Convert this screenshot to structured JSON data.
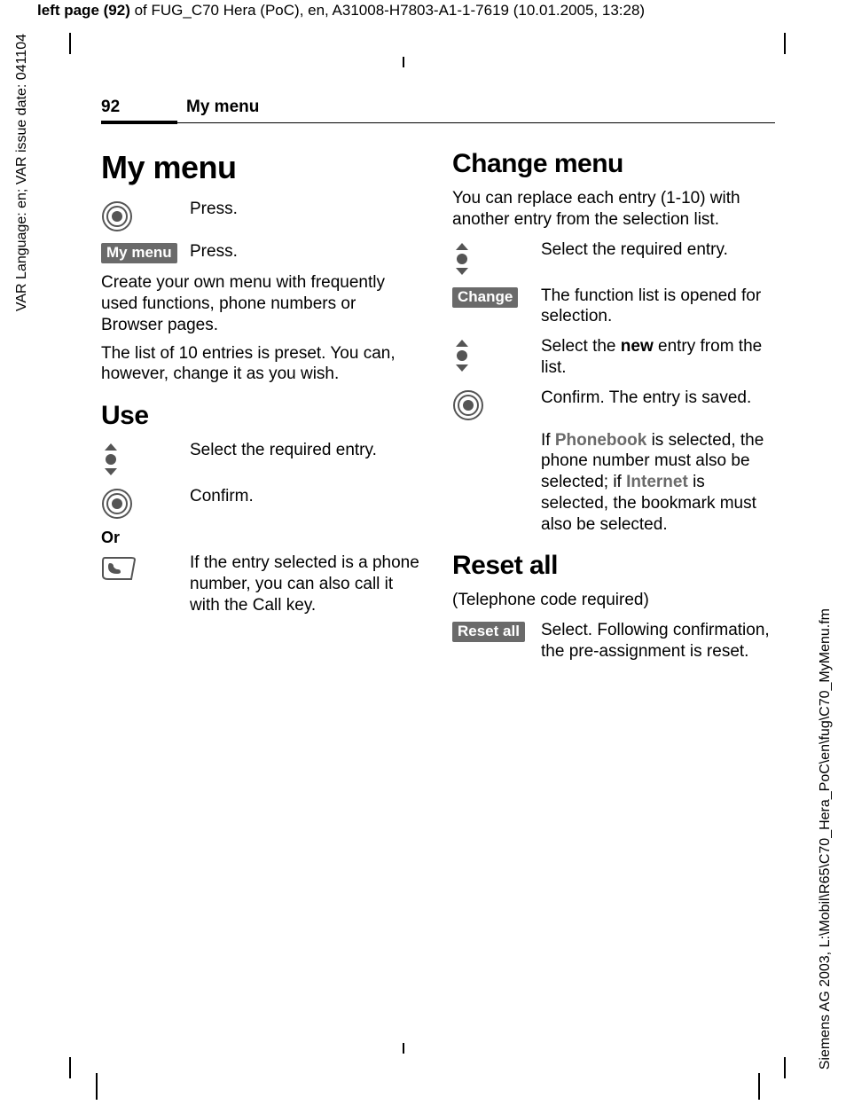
{
  "meta": {
    "top_bold": "left page (92)",
    "top_rest": " of FUG_C70 Hera (PoC), en, A31008-H7803-A1-1-7619 (10.01.2005, 13:28)",
    "side_left": "VAR Language: en; VAR issue date: 041104",
    "side_right": "Siemens AG 2003, L:\\Mobil\\R65\\C70_Hera_PoC\\en\\fug\\C70_MyMenu.fm"
  },
  "runhead": {
    "page_num": "92",
    "title": "My menu"
  },
  "left": {
    "title": "My menu",
    "press1": "Press.",
    "softkey_mymenu": "My menu",
    "press2": "Press.",
    "intro": "Create your own menu with frequently used functions, phone numbers or Browser pages.",
    "list_note": "The list of 10 entries is preset. You can, however, change it as you wish.",
    "use_heading": "Use",
    "use_select": "Select the required entry.",
    "use_confirm": "Confirm.",
    "or": "Or",
    "use_call": "If the entry selected is a phone number, you can also call it with the Call key."
  },
  "right": {
    "change_heading": "Change menu",
    "change_intro": "You can replace each entry (1-10) with another entry from the selection list.",
    "change_select": "Select the required entry.",
    "softkey_change": "Change",
    "change_open": "The function list is opened for selection.",
    "change_new_pre": "Select the ",
    "change_new_bold": "new",
    "change_new_post": " entry from the list.",
    "change_confirm": "Confirm. The entry is saved.",
    "change_note_pre": "If ",
    "change_note_pb": "Phonebook",
    "change_note_mid": " is selected, the phone number must also be selected; if ",
    "change_note_inet": "Internet",
    "change_note_post": " is selected, the bookmark must also be selected.",
    "reset_heading": "Reset all",
    "reset_sub": "(Telephone code required)",
    "softkey_reset": "Reset all",
    "reset_text": "Select. Following confirmation, the pre-assignment is reset."
  }
}
